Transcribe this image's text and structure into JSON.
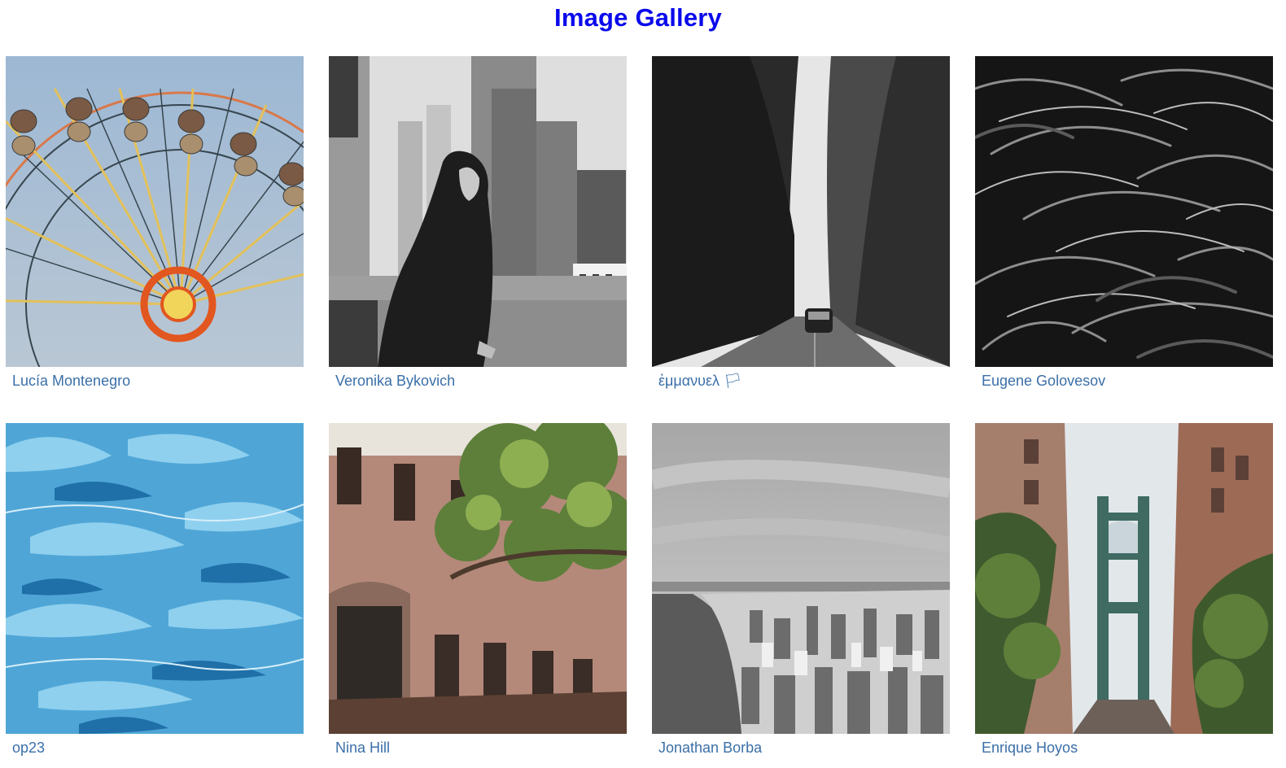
{
  "page": {
    "title": "Image Gallery"
  },
  "gallery": {
    "items": [
      {
        "author": "Lucía Montenegro",
        "icon": "ferris-wheel-photo"
      },
      {
        "author": "Veronika Bykovich",
        "icon": "city-woman-photo"
      },
      {
        "author": "ἐμμανυελ 🏳",
        "icon": "foggy-road-photo"
      },
      {
        "author": "Eugene Golovesov",
        "icon": "grass-photo"
      },
      {
        "author": "op23",
        "icon": "blue-texture-photo"
      },
      {
        "author": "Nina Hill",
        "icon": "brownstone-photo"
      },
      {
        "author": "Jonathan Borba",
        "icon": "aerial-city-photo"
      },
      {
        "author": "Enrique Hoyos",
        "icon": "bridge-street-photo"
      }
    ]
  },
  "colors": {
    "title": "#0a0aec",
    "caption": "#3b6fa8"
  }
}
